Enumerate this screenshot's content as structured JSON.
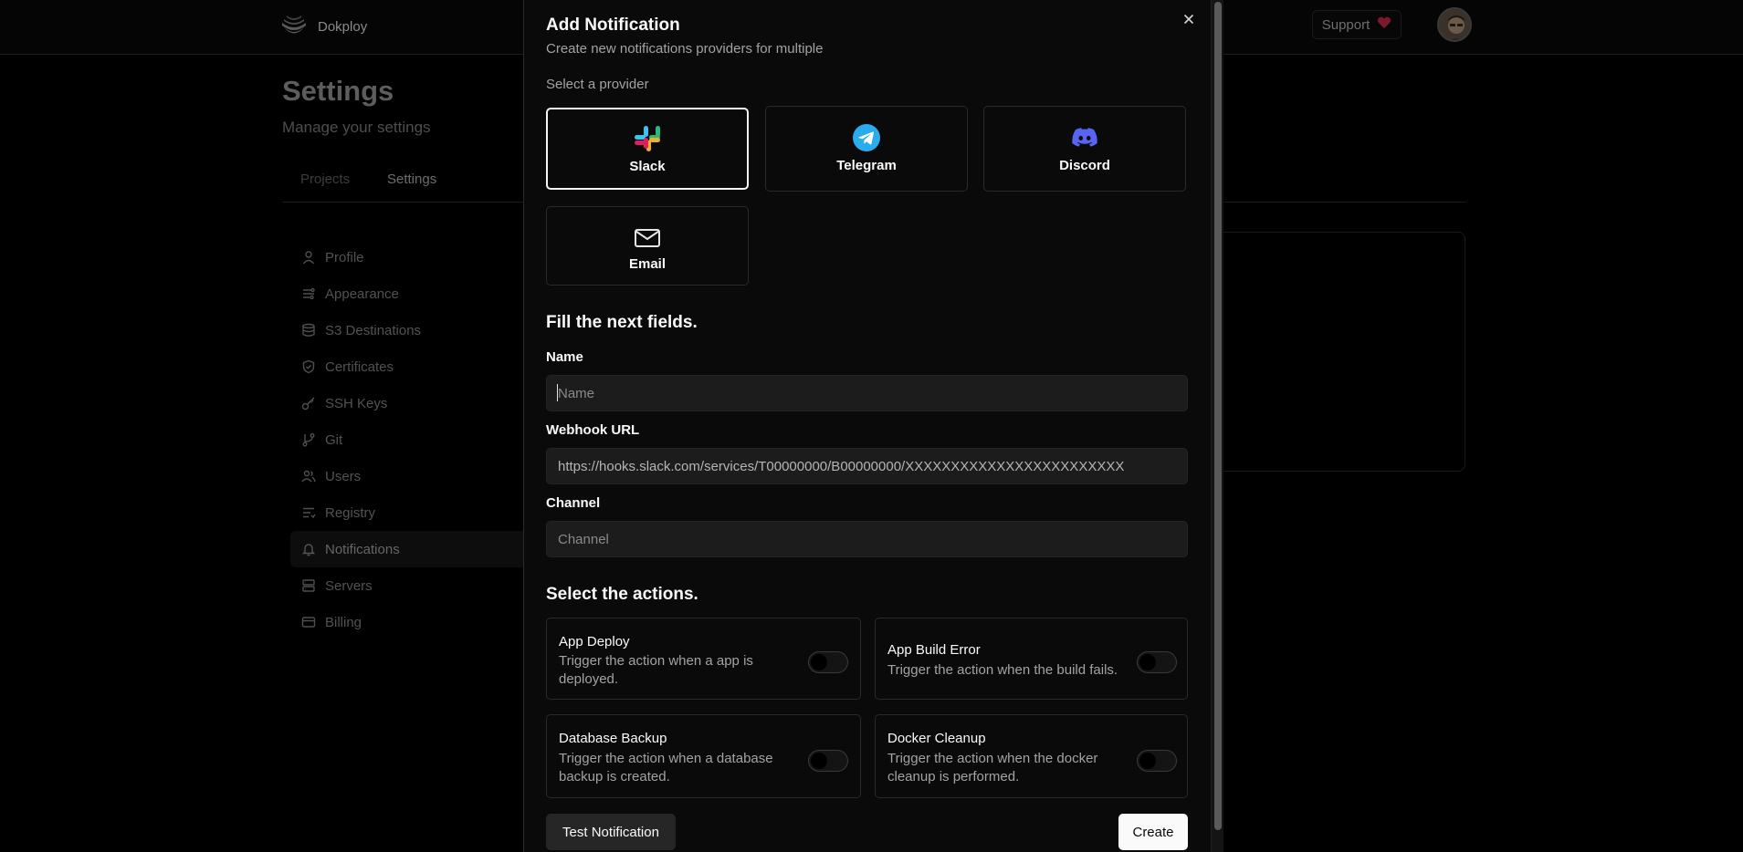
{
  "app": {
    "brand_name": "Dokploy",
    "support_label": "Support",
    "page_title": "Settings",
    "page_subtitle": "Manage your settings",
    "tabs": [
      {
        "label": "Projects"
      },
      {
        "label": "Settings"
      }
    ]
  },
  "sidebar": {
    "items": [
      {
        "label": "Profile",
        "icon": "user-icon"
      },
      {
        "label": "Appearance",
        "icon": "palette-icon"
      },
      {
        "label": "S3 Destinations",
        "icon": "database-icon"
      },
      {
        "label": "Certificates",
        "icon": "shield-check-icon"
      },
      {
        "label": "SSH Keys",
        "icon": "key-icon"
      },
      {
        "label": "Git",
        "icon": "git-branch-icon"
      },
      {
        "label": "Users",
        "icon": "users-icon"
      },
      {
        "label": "Registry",
        "icon": "list-icon"
      },
      {
        "label": "Notifications",
        "icon": "bell-icon",
        "active": true
      },
      {
        "label": "Servers",
        "icon": "server-icon"
      },
      {
        "label": "Billing",
        "icon": "credit-card-icon"
      }
    ]
  },
  "modal": {
    "title": "Add Notification",
    "description": "Create new notifications providers for multiple",
    "provider_label": "Select a provider",
    "providers": [
      {
        "label": "Slack",
        "icon": "slack-icon",
        "selected": true
      },
      {
        "label": "Telegram",
        "icon": "telegram-icon"
      },
      {
        "label": "Discord",
        "icon": "discord-icon"
      },
      {
        "label": "Email",
        "icon": "mail-icon"
      }
    ],
    "fields_heading": "Fill the next fields.",
    "fields": {
      "name": {
        "label": "Name",
        "placeholder": "Name",
        "value": ""
      },
      "webhook": {
        "label": "Webhook URL",
        "value": "https://hooks.slack.com/services/T00000000/B00000000/XXXXXXXXXXXXXXXXXXXXXXXX"
      },
      "channel": {
        "label": "Channel",
        "placeholder": "Channel",
        "value": ""
      }
    },
    "actions_heading": "Select the actions.",
    "actions": [
      {
        "title": "App Deploy",
        "description": "Trigger the action when a app is deployed.",
        "enabled": false
      },
      {
        "title": "App Build Error",
        "description": "Trigger the action when the build fails.",
        "enabled": false
      },
      {
        "title": "Database Backup",
        "description": "Trigger the action when a database backup is created.",
        "enabled": false
      },
      {
        "title": "Docker Cleanup",
        "description": "Trigger the action when the docker cleanup is performed.",
        "enabled": false
      }
    ],
    "test_button": "Test Notification",
    "create_button": "Create"
  },
  "colors": {
    "slack_green": "#2EB67D",
    "slack_blue": "#36C5F0",
    "slack_yellow": "#ECB22E",
    "slack_red": "#E01E5A",
    "telegram": "#2AABEE",
    "discord": "#5865F2",
    "support_heart": "#e11d48"
  }
}
